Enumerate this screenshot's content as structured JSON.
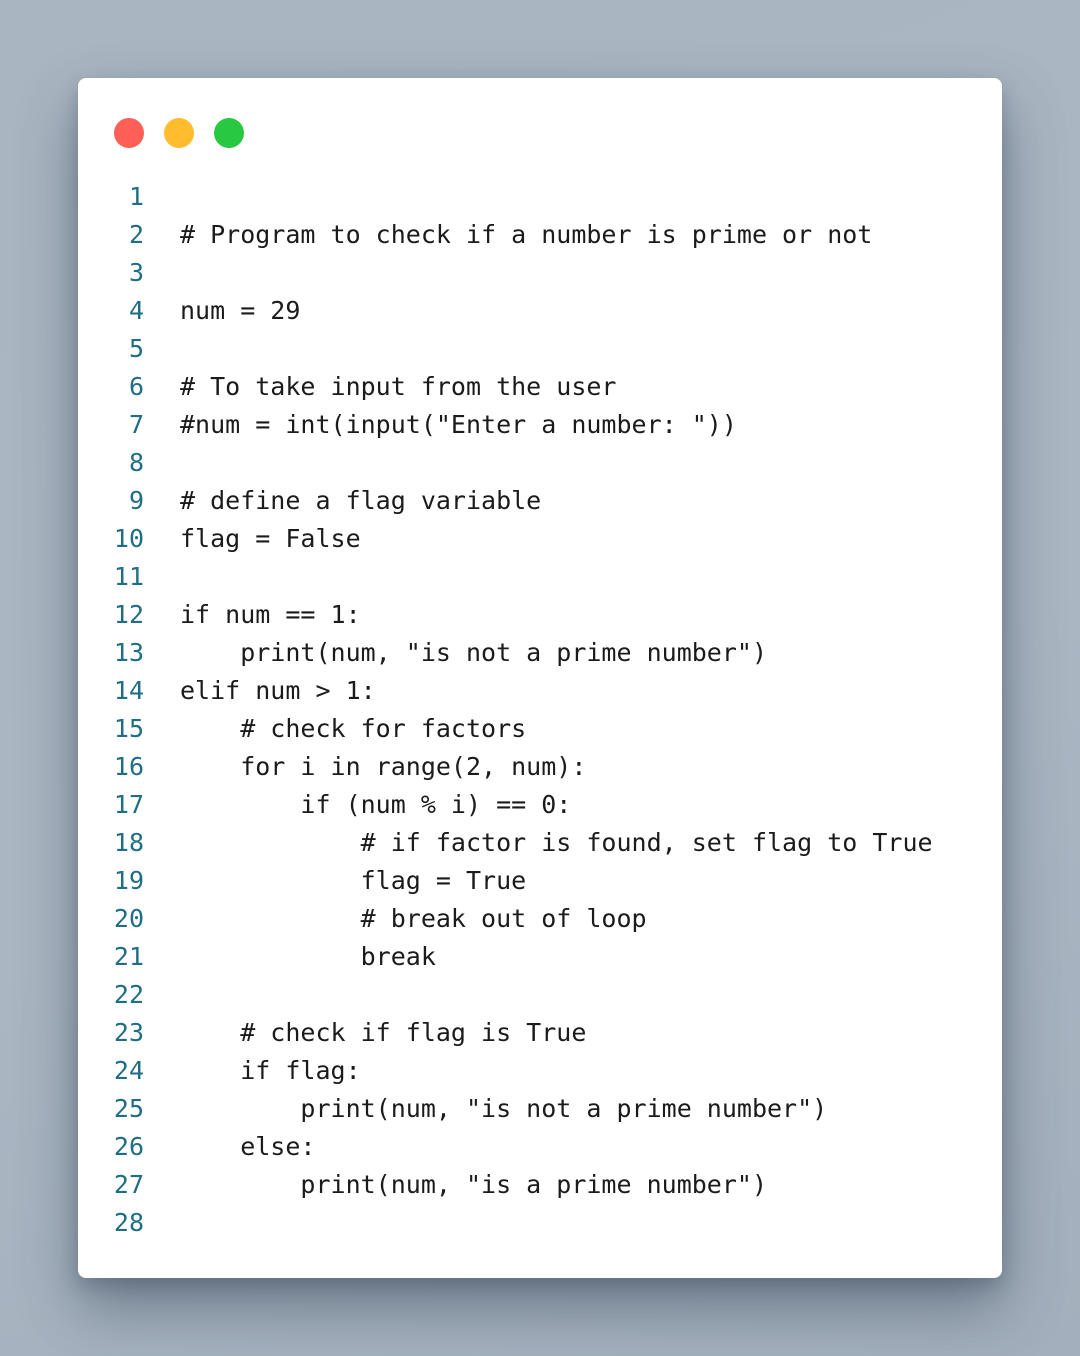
{
  "window": {
    "controls": [
      {
        "name": "close",
        "color": "#ff5f57"
      },
      {
        "name": "minimize",
        "color": "#febc2e"
      },
      {
        "name": "maximize",
        "color": "#28c840"
      }
    ]
  },
  "editor": {
    "lines": [
      {
        "n": "1",
        "code": ""
      },
      {
        "n": "2",
        "code": "# Program to check if a number is prime or not"
      },
      {
        "n": "3",
        "code": ""
      },
      {
        "n": "4",
        "code": "num = 29"
      },
      {
        "n": "5",
        "code": ""
      },
      {
        "n": "6",
        "code": "# To take input from the user"
      },
      {
        "n": "7",
        "code": "#num = int(input(\"Enter a number: \"))"
      },
      {
        "n": "8",
        "code": ""
      },
      {
        "n": "9",
        "code": "# define a flag variable"
      },
      {
        "n": "10",
        "code": "flag = False"
      },
      {
        "n": "11",
        "code": ""
      },
      {
        "n": "12",
        "code": "if num == 1:"
      },
      {
        "n": "13",
        "code": "    print(num, \"is not a prime number\")"
      },
      {
        "n": "14",
        "code": "elif num > 1:"
      },
      {
        "n": "15",
        "code": "    # check for factors"
      },
      {
        "n": "16",
        "code": "    for i in range(2, num):"
      },
      {
        "n": "17",
        "code": "        if (num % i) == 0:"
      },
      {
        "n": "18",
        "code": "            # if factor is found, set flag to True"
      },
      {
        "n": "19",
        "code": "            flag = True"
      },
      {
        "n": "20",
        "code": "            # break out of loop"
      },
      {
        "n": "21",
        "code": "            break"
      },
      {
        "n": "22",
        "code": ""
      },
      {
        "n": "23",
        "code": "    # check if flag is True"
      },
      {
        "n": "24",
        "code": "    if flag:"
      },
      {
        "n": "25",
        "code": "        print(num, \"is not a prime number\")"
      },
      {
        "n": "26",
        "code": "    else:"
      },
      {
        "n": "27",
        "code": "        print(num, \"is a prime number\")"
      },
      {
        "n": "28",
        "code": ""
      }
    ]
  }
}
